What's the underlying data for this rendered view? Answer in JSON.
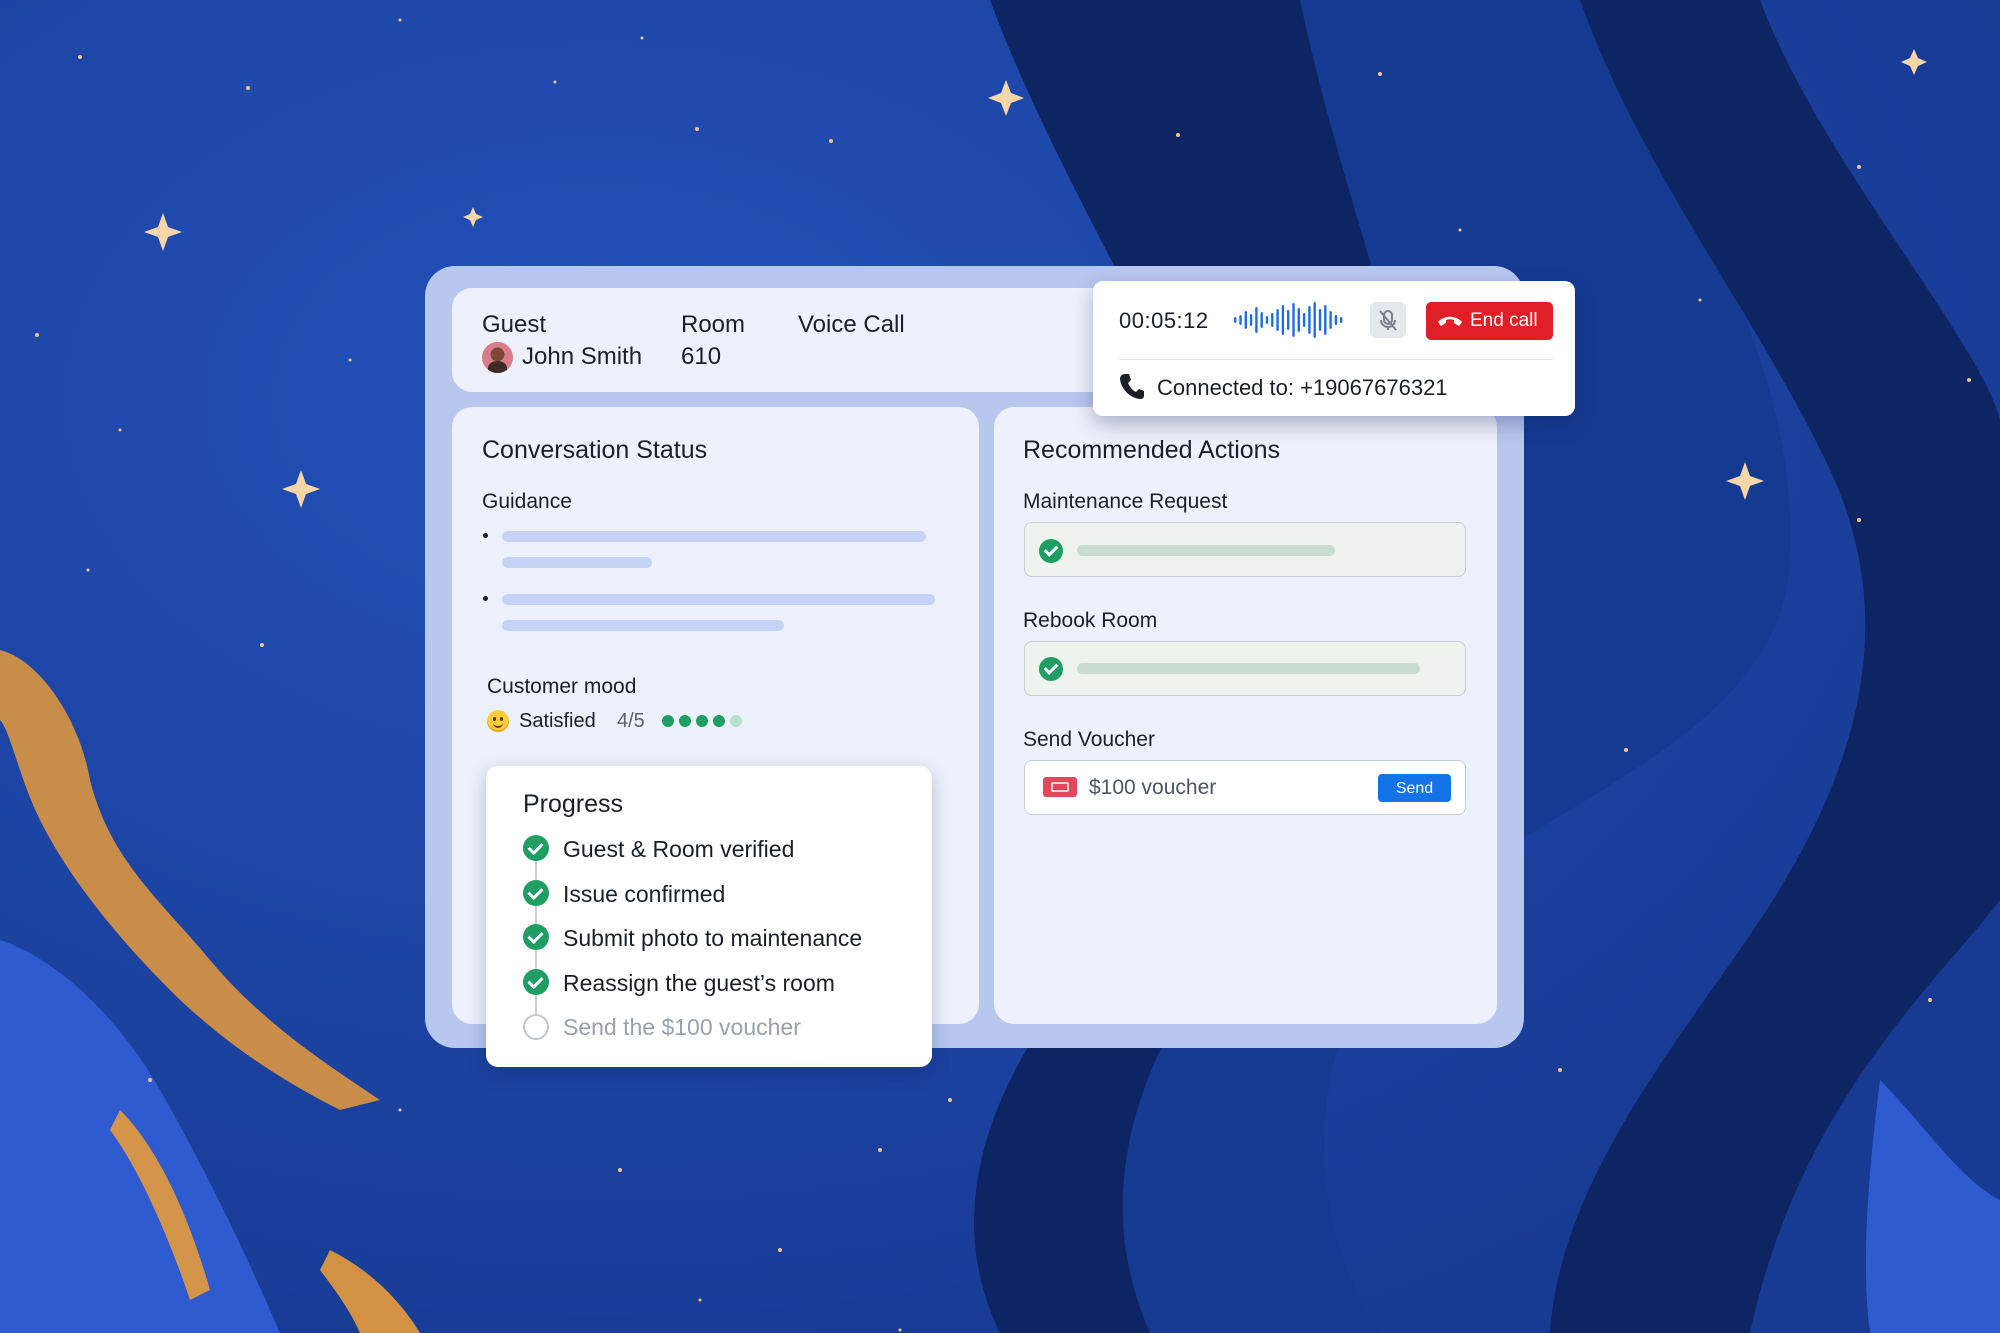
{
  "header": {
    "guest_label": "Guest",
    "guest_name": "John Smith",
    "room_label": "Room",
    "room_number": "610",
    "channel": "Voice Call"
  },
  "call": {
    "timer": "00:05:12",
    "end_label": "End call",
    "connected_text": "Connected to: +19067676321",
    "end_color": "#e01f26"
  },
  "conversation": {
    "title": "Conversation Status",
    "guidance_label": "Guidance",
    "mood_label": "Customer mood",
    "mood_value": "Satisfied",
    "mood_score": "4/5",
    "mood_rating": 4,
    "mood_max": 5
  },
  "progress": {
    "title": "Progress",
    "steps": [
      {
        "label": "Guest & Room verified",
        "done": true
      },
      {
        "label": "Issue confirmed",
        "done": true
      },
      {
        "label": "Submit photo to maintenance",
        "done": true
      },
      {
        "label": "Reassign the guest’s room",
        "done": true
      },
      {
        "label": "Send the $100 voucher",
        "done": false
      }
    ]
  },
  "actions": {
    "title": "Recommended Actions",
    "items": [
      {
        "label": "Maintenance Request",
        "status": "done"
      },
      {
        "label": "Rebook Room",
        "status": "done"
      },
      {
        "label": "Send Voucher",
        "status": "pending"
      }
    ],
    "voucher_text": "$100 voucher",
    "send_label": "Send"
  },
  "colors": {
    "accent": "#1473e6",
    "success": "#1e9e62",
    "background": "#1b3f9c"
  }
}
